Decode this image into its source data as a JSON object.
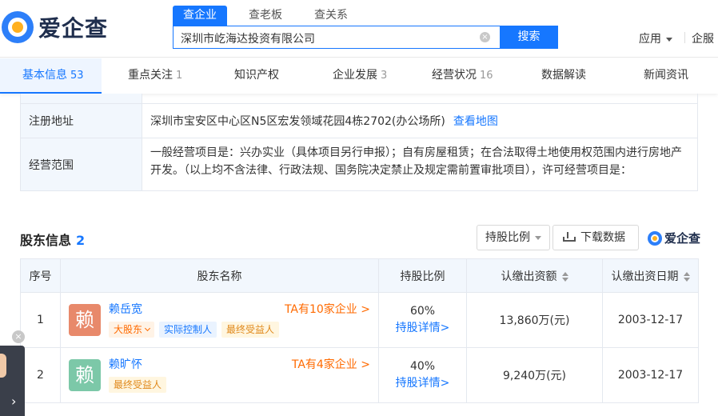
{
  "header": {
    "logo_text": "爱企查",
    "search_tabs": [
      "查企业",
      "查老板",
      "查关系"
    ],
    "search_value": "深圳市屹海达投资有限公司",
    "search_button": "搜索",
    "apps_label": "应用",
    "service_label": "企服"
  },
  "nav": {
    "tabs": [
      {
        "label": "基本信息",
        "count": "53"
      },
      {
        "label": "重点关注",
        "count": "1"
      },
      {
        "label": "知识产权",
        "count": ""
      },
      {
        "label": "企业发展",
        "count": "3"
      },
      {
        "label": "经营状况",
        "count": "16"
      },
      {
        "label": "数据解读",
        "count": ""
      },
      {
        "label": "新闻资讯",
        "count": ""
      }
    ]
  },
  "info": {
    "address_label": "注册地址",
    "address_value": "深圳市宝安区中心区N5区宏发领域花园4栋2702(办公场所)",
    "map_link": "查看地图",
    "scope_label": "经营范围",
    "scope_value": "一般经营项目是：兴办实业（具体项目另行申报）；自有房屋租赁；在合法取得土地使用权范围内进行房地产开发。（以上均不含法律、行政法规、国务院决定禁止及规定需前置审批项目），许可经营项目是："
  },
  "shareholders": {
    "title": "股东信息",
    "count": "2",
    "filter_label": "持股比例",
    "download_label": "下载数据",
    "brand": "爱企查",
    "columns": [
      "序号",
      "股东名称",
      "持股比例",
      "认缴出资额",
      "认缴出资日期"
    ],
    "rows": [
      {
        "index": "1",
        "avatar_char": "赖",
        "avatar_color": "#e8896b",
        "name": "赖岳宽",
        "ta_link": "TA有10家企业 >",
        "tags": [
          "大股东",
          "实际控制人",
          "最终受益人"
        ],
        "ratio": "60%",
        "detail_link": "持股详情>",
        "amount": "13,860万(元)",
        "date": "2003-12-17"
      },
      {
        "index": "2",
        "avatar_char": "赖",
        "avatar_color": "#7cc8a8",
        "name": "赖旷怀",
        "ta_link": "TA有4家企业 >",
        "tags": [
          "最终受益人"
        ],
        "ratio": "40%",
        "detail_link": "持股详情>",
        "amount": "9,240万(元)",
        "date": "2003-12-17"
      }
    ]
  },
  "colors": {
    "primary": "#1677ff",
    "accent_orange": "#ff6a00",
    "header_bg": "#f2f7fd"
  }
}
